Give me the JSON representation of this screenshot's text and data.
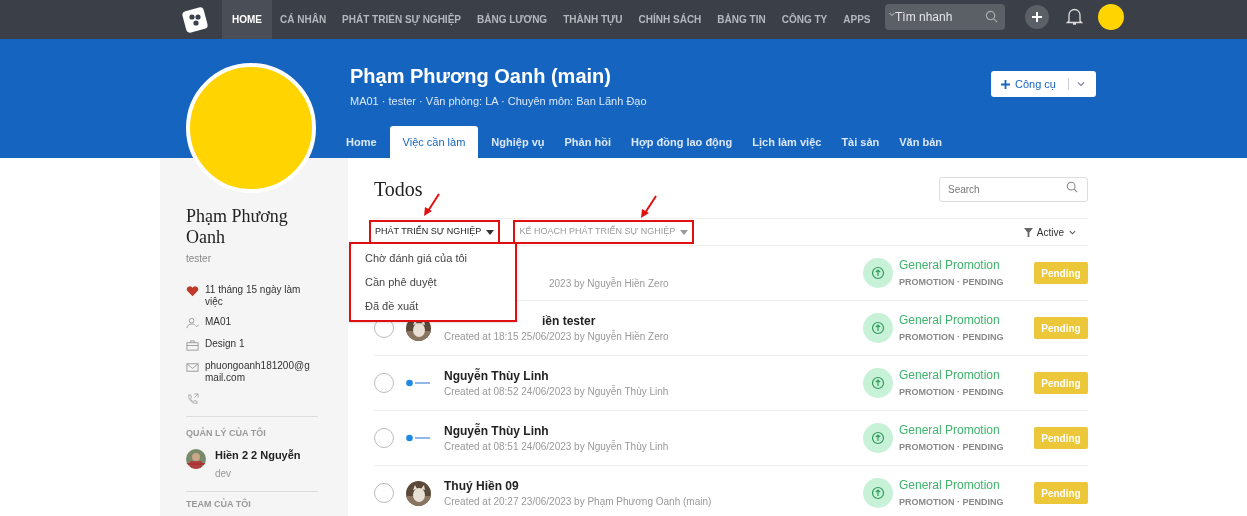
{
  "top_nav": {
    "items": [
      {
        "label": "HOME",
        "selected": true
      },
      {
        "label": "CÁ NHÂN",
        "selected": false
      },
      {
        "label": "PHÁT TRIỂN SỰ NGHIỆP",
        "selected": false
      },
      {
        "label": "BẢNG LƯƠNG",
        "selected": false
      },
      {
        "label": "THÀNH TỰU",
        "selected": false
      },
      {
        "label": "CHÍNH SÁCH",
        "selected": false
      },
      {
        "label": "BẢNG TIN",
        "selected": false
      },
      {
        "label": "CÔNG TY",
        "selected": false
      },
      {
        "label": "APPS",
        "selected": false
      }
    ],
    "search": {
      "placeholder": "Tìm nhanh"
    }
  },
  "profile_header": {
    "name": "Phạm Phương Oanh (main)",
    "meta": "MA01 · tester · Văn phòng: LA · Chuyên môn: Ban Lãnh Đạo",
    "tools_button": "Công cụ",
    "tabs": [
      {
        "label": "Home",
        "selected": false
      },
      {
        "label": "Việc cần làm",
        "selected": true
      },
      {
        "label": "Nghiệp vụ",
        "selected": false
      },
      {
        "label": "Phản hồi",
        "selected": false
      },
      {
        "label": "Hợp đồng lao động",
        "selected": false
      },
      {
        "label": "Lịch làm việc",
        "selected": false
      },
      {
        "label": "Tài sản",
        "selected": false
      },
      {
        "label": "Văn bản",
        "selected": false
      }
    ]
  },
  "sidebar": {
    "name": "Phạm Phương Oanh",
    "role": "tester",
    "details": [
      {
        "kind": "heart",
        "text": "11 tháng 15 ngày làm việc"
      },
      {
        "kind": "user",
        "text": "MA01"
      },
      {
        "kind": "briefcase",
        "text": "Design 1"
      },
      {
        "kind": "mail",
        "text": "phuongoanh181200@gmail.com"
      },
      {
        "kind": "phone"
      }
    ],
    "manager_heading": "QUẢN LÝ CỦA TÔI",
    "manager": {
      "name": "Hiền 2 2 Nguyễn",
      "role": "dev"
    },
    "team_heading": "TEAM CỦA TÔI"
  },
  "todos": {
    "title": "Todos",
    "search": {
      "placeholder": "Search"
    },
    "filters": [
      {
        "label": "PHÁT TRIỂN SỰ NGHIỆP",
        "open": true
      },
      {
        "label": "KẾ HOẠCH PHÁT TRIỂN SỰ NGHIỆP",
        "open": false
      }
    ],
    "status_filter": "Active",
    "dropdown": [
      "Chờ đánh giá của tôi",
      "Cần phê duyệt",
      "Đã đề xuất"
    ],
    "rows": [
      {
        "kind": "covered",
        "created": "2023 by Nguyễn Hiền Zero",
        "type_title": "General Promotion",
        "type_meta": "PROMOTION · PENDING",
        "status": "Pending"
      },
      {
        "kind": "partly_covered",
        "checked": false,
        "title": "iền tester",
        "created": "Created at 18:15 25/06/2023 by Nguyễn Hiền Zero",
        "type_title": "General Promotion",
        "type_meta": "PROMOTION · PENDING",
        "status": "Pending"
      },
      {
        "kind": "plain",
        "checked": false,
        "avatar": {
          "kind": "logo"
        },
        "title": "Nguyễn Thùy Linh",
        "created": "Created at 08:52 24/06/2023 by Nguyễn Thùy Linh",
        "type_title": "General Promotion",
        "type_meta": "PROMOTION · PENDING",
        "status": "Pending"
      },
      {
        "kind": "plain",
        "checked": false,
        "avatar": {
          "kind": "logo"
        },
        "title": "Nguyễn Thùy Linh",
        "created": "Created at 08:51 24/06/2023 by Nguyễn Thùy Linh",
        "type_title": "General Promotion",
        "type_meta": "PROMOTION · PENDING",
        "status": "Pending"
      },
      {
        "kind": "plain",
        "checked": false,
        "title": "Thuý Hiền 09",
        "created": "Created at 20:27 23/06/2023 by Phạm Phương Oanh (main)",
        "type_title": "General Promotion",
        "type_meta": "PROMOTION · PENDING",
        "status": "Pending"
      }
    ]
  }
}
